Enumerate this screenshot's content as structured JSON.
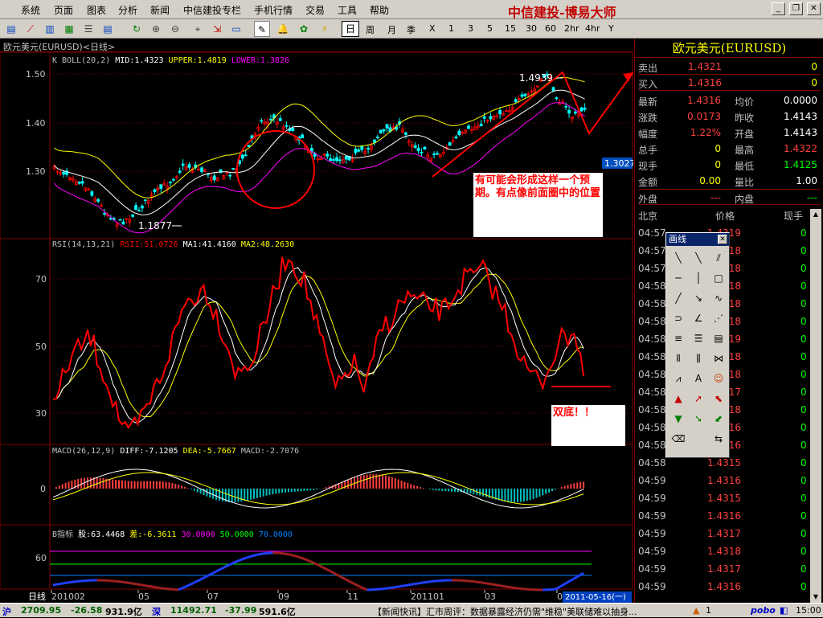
{
  "menu": {
    "items": [
      "系统",
      "页面",
      "图表",
      "分析",
      "新闻",
      "中信建投专栏",
      "手机行情",
      "交易",
      "工具",
      "帮助"
    ],
    "brand": "中信建投-博易大师"
  },
  "toolbar": {
    "day_button": "日",
    "periods": [
      "周",
      "月",
      "季",
      "X",
      "1",
      "3",
      "5",
      "15",
      "30",
      "60",
      "2hr",
      "4hr",
      "Y"
    ]
  },
  "chart": {
    "title": "欧元美元(EURUSD)<日线>",
    "boll": {
      "name": "K BOLL(20,2)",
      "mid": "MID:1.4323",
      "upper": "UPPER:1.4819",
      "lower": "LOWER:1.3826"
    },
    "price_ticks": [
      "1.50",
      "1.40",
      "1.30"
    ],
    "price_high_label": "1.4939",
    "price_low_label": "1.1877",
    "current_price_tag": "1.3027",
    "rsi": {
      "name": "RSI(14,13,21)",
      "rsi1": "RSI1:51.0726",
      "ma1": "MA1:41.4160",
      "ma2": "MA2:48.2630"
    },
    "rsi_ticks": [
      "70",
      "50",
      "30"
    ],
    "macd": {
      "name": "MACD(26,12,9)",
      "diff": "DIFF:-7.1205",
      "dea": "DEA:-5.7667",
      "macd": "MACD:-2.7076"
    },
    "macd_ticks": [
      "0"
    ],
    "b": {
      "name": "B指标",
      "gu": "股:63.4468",
      "cha": "差:-6.3611",
      "v1": "30.0000",
      "v2": "50.0000",
      "v3": "70.0000"
    },
    "b_ticks": [
      "60"
    ],
    "x_axis": {
      "label": "日线",
      "ticks": [
        "201002",
        "05",
        "07",
        "09",
        "11",
        "201101",
        "03",
        "05"
      ],
      "cursor_date": "2011-05-16(一)"
    },
    "notes": {
      "forecast": "有可能会形成这样一个预期。有点像前面圈中的位置",
      "double_bottom": "双底！！"
    }
  },
  "quote": {
    "title": "欧元美元(EURUSD)",
    "sell": {
      "label": "卖出",
      "price": "1.4321",
      "vol": "0"
    },
    "buy": {
      "label": "买入",
      "price": "1.4316",
      "vol": "0"
    },
    "rows": [
      {
        "l1": "最新",
        "v1": "1.4316",
        "l2": "均价",
        "v2": "0.0000",
        "c1": "#ff4040",
        "c2": "#ffffff"
      },
      {
        "l1": "涨跌",
        "v1": "0.0173",
        "l2": "昨收",
        "v2": "1.4143",
        "c1": "#ff4040",
        "c2": "#ffffff"
      },
      {
        "l1": "幅度",
        "v1": "1.22%",
        "l2": "开盘",
        "v2": "1.4143",
        "c1": "#ff4040",
        "c2": "#ffffff"
      },
      {
        "l1": "总手",
        "v1": "0",
        "l2": "最高",
        "v2": "1.4322",
        "c1": "#ffff00",
        "c2": "#ff4040"
      },
      {
        "l1": "现手",
        "v1": "0",
        "l2": "最低",
        "v2": "1.4125",
        "c1": "#ffff00",
        "c2": "#00ff00"
      },
      {
        "l1": "金额",
        "v1": "0.00",
        "l2": "量比",
        "v2": "1.00",
        "c1": "#ffff00",
        "c2": "#ffffff"
      }
    ],
    "outer": {
      "label": "外盘",
      "value": "---"
    },
    "inner": {
      "label": "内盘",
      "value": "---"
    },
    "tick_header": [
      "北京",
      "价格",
      "现手"
    ],
    "ticks": [
      {
        "t": "04:57",
        "p": "1.4319",
        "q": "0"
      },
      {
        "t": "04:57",
        "p": "1.4318",
        "q": "0"
      },
      {
        "t": "04:57",
        "p": "1.4318",
        "q": "0"
      },
      {
        "t": "04:58",
        "p": "1.4318",
        "q": "0"
      },
      {
        "t": "04:58",
        "p": "1.4318",
        "q": "0"
      },
      {
        "t": "04:58",
        "p": "1.4318",
        "q": "0"
      },
      {
        "t": "04:58",
        "p": "1.4319",
        "q": "0"
      },
      {
        "t": "04:58",
        "p": "1.4318",
        "q": "0"
      },
      {
        "t": "04:58",
        "p": "1.4318",
        "q": "0"
      },
      {
        "t": "04:58",
        "p": "1.4317",
        "q": "0"
      },
      {
        "t": "04:58",
        "p": "1.4318",
        "q": "0"
      },
      {
        "t": "04:58",
        "p": "1.4316",
        "q": "0"
      },
      {
        "t": "04:58",
        "p": "1.4316",
        "q": "0"
      },
      {
        "t": "04:58",
        "p": "1.4315",
        "q": "0"
      },
      {
        "t": "04:59",
        "p": "1.4316",
        "q": "0"
      },
      {
        "t": "04:59",
        "p": "1.4315",
        "q": "0"
      },
      {
        "t": "04:59",
        "p": "1.4316",
        "q": "0"
      },
      {
        "t": "04:59",
        "p": "1.4317",
        "q": "0"
      },
      {
        "t": "04:59",
        "p": "1.4318",
        "q": "0"
      },
      {
        "t": "04:59",
        "p": "1.4317",
        "q": "0"
      },
      {
        "t": "04:59",
        "p": "1.4316",
        "q": "0"
      }
    ]
  },
  "drawtools": {
    "title": "画线"
  },
  "statusbar": {
    "sh_label": "沪",
    "sh_index": "2709.95",
    "sh_change": "-26.58",
    "sh_amount": "931.9亿",
    "sz_label": "深",
    "sz_index": "11492.71",
    "sz_change": "-37.99",
    "sz_amount": "591.6亿",
    "news": "【新闻快讯】汇市周评：数据暴露经济仍需\"维稳\"美联储难以抽身...",
    "alerts": "1",
    "app": "pobo",
    "clock": "15:00"
  },
  "colors": {
    "up": "#ff0000",
    "down": "#00ffff",
    "boll_mid": "#ffffff",
    "boll_upper": "#ffff00",
    "boll_lower": "#ff00ff",
    "grid": "#800000"
  }
}
